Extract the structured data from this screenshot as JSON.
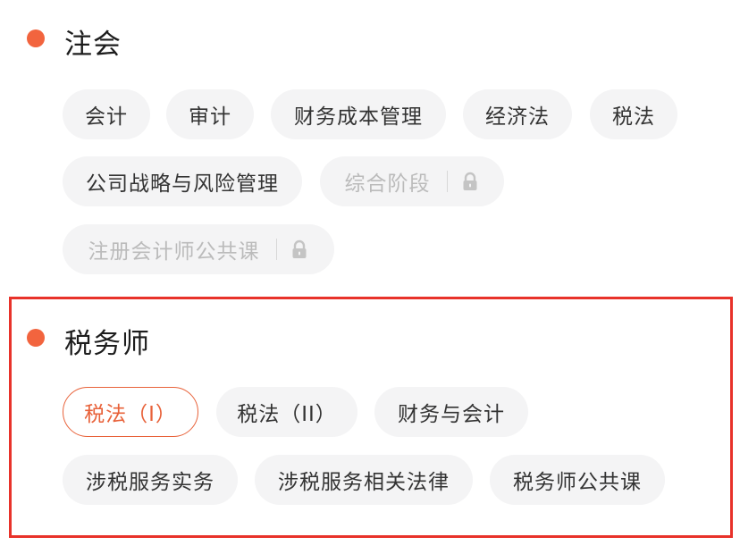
{
  "colors": {
    "accent": "#f2643e",
    "highlight_border": "#e8322a",
    "chip_bg": "#f4f4f5"
  },
  "sections": [
    {
      "title": "注会",
      "chips": [
        {
          "label": "会计",
          "disabled": false
        },
        {
          "label": "审计",
          "disabled": false
        },
        {
          "label": "财务成本管理",
          "disabled": false
        },
        {
          "label": "经济法",
          "disabled": false
        },
        {
          "label": "税法",
          "disabled": false
        },
        {
          "label": "公司战略与风险管理",
          "disabled": false
        },
        {
          "label": "综合阶段",
          "disabled": true,
          "icon": "lock-icon"
        },
        {
          "label": "注册会计师公共课",
          "disabled": true,
          "icon": "lock-icon"
        }
      ]
    },
    {
      "title": "税务师",
      "chips": [
        {
          "label": "税法（I）",
          "selected": true
        },
        {
          "label": "税法（II）",
          "selected": false
        },
        {
          "label": "财务与会计",
          "selected": false
        },
        {
          "label": "涉税服务实务",
          "selected": false
        },
        {
          "label": "涉税服务相关法律",
          "selected": false
        },
        {
          "label": "税务师公共课",
          "selected": false
        }
      ]
    }
  ]
}
